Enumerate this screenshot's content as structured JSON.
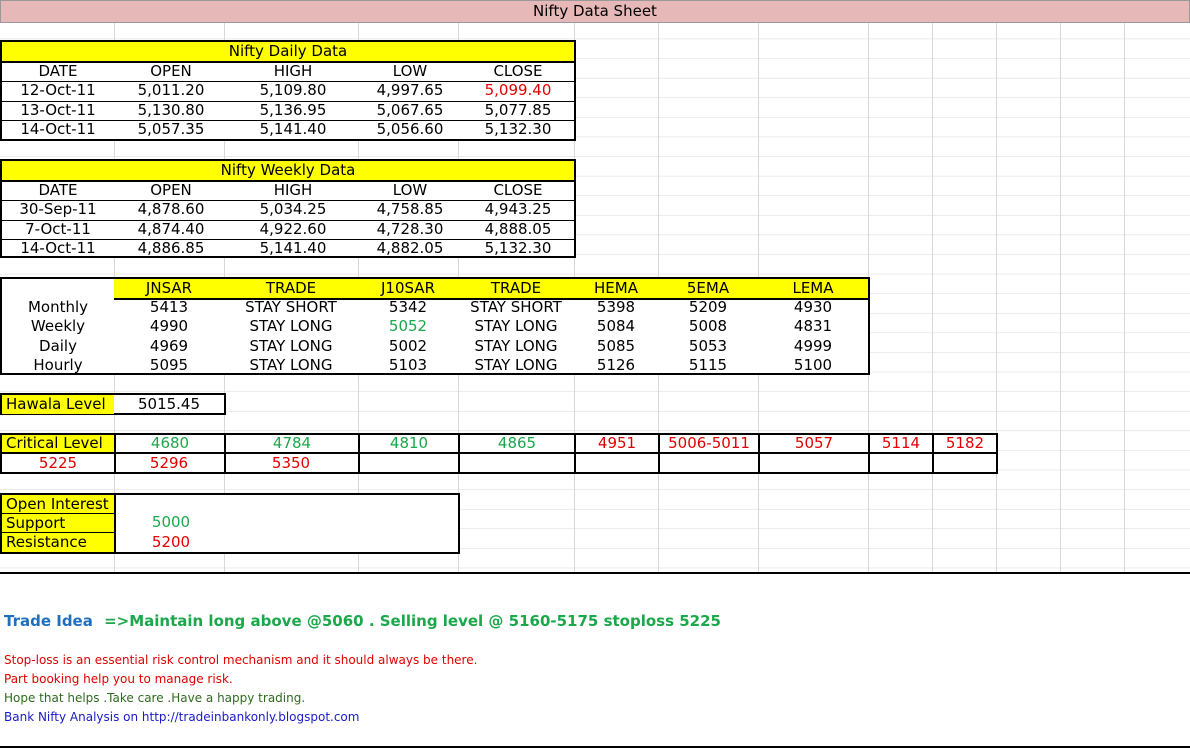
{
  "title": "Nifty Data Sheet",
  "daily": {
    "heading": "Nifty Daily Data",
    "columns": [
      "DATE",
      "OPEN",
      "HIGH",
      "LOW",
      "CLOSE"
    ],
    "rows": [
      [
        "12-Oct-11",
        "5,011.20",
        "5,109.80",
        "4,997.65",
        "5,099.40"
      ],
      [
        "13-Oct-11",
        "5,130.80",
        "5,136.95",
        "5,067.65",
        "5,077.85"
      ],
      [
        "14-Oct-11",
        "5,057.35",
        "5,141.40",
        "5,056.60",
        "5,132.30"
      ]
    ]
  },
  "weekly": {
    "heading": "Nifty Weekly Data",
    "columns": [
      "DATE",
      "OPEN",
      "HIGH",
      "LOW",
      "CLOSE"
    ],
    "rows": [
      [
        "30-Sep-11",
        "4,878.60",
        "5,034.25",
        "4,758.85",
        "4,943.25"
      ],
      [
        "7-Oct-11",
        "4,874.40",
        "4,922.60",
        "4,728.30",
        "4,888.05"
      ],
      [
        "14-Oct-11",
        "4,886.85",
        "5,141.40",
        "4,882.05",
        "5,132.30"
      ]
    ]
  },
  "indicators": {
    "columns": [
      "",
      "JNSAR",
      "TRADE",
      "J10SAR",
      "TRADE",
      "HEMA",
      "5EMA",
      "LEMA"
    ],
    "rows": [
      [
        "Monthly",
        "5413",
        "STAY SHORT",
        "5342",
        "STAY SHORT",
        "5398",
        "5209",
        "4930"
      ],
      [
        "Weekly",
        "4990",
        "STAY LONG",
        "5052",
        "STAY LONG",
        "5084",
        "5008",
        "4831"
      ],
      [
        "Daily",
        "4969",
        "STAY LONG",
        "5002",
        "STAY LONG",
        "5085",
        "5053",
        "4999"
      ],
      [
        "Hourly",
        "5095",
        "STAY LONG",
        "5103",
        "STAY LONG",
        "5126",
        "5115",
        "5100"
      ]
    ]
  },
  "hawala": {
    "label": "Hawala Level",
    "value": "5015.45"
  },
  "critical": {
    "label": "Critical Level",
    "row1": [
      "4680",
      "4784",
      "4810",
      "4865",
      "4951",
      "5006-5011",
      "5057",
      "5114",
      "5182"
    ],
    "row2": [
      "5225",
      "5296",
      "5350"
    ]
  },
  "open_interest": {
    "label": "Open Interest",
    "support_label": "Support",
    "support_value": "5000",
    "resistance_label": "Resistance",
    "resistance_value": "5200"
  },
  "trade_idea": {
    "label": "Trade Idea",
    "text": "=>Maintain long above @5060 . Selling level @  5160-5175 stoploss 5225"
  },
  "notes": [
    "Stop-loss is an essential risk control mechanism and it should always be there.",
    "Part booking help you to manage risk.",
    "Hope that helps .Take care .Have a happy trading.",
    "Bank Nifty Analysis on http://tradeinbankonly.blogspot.com"
  ],
  "colors": {
    "header_fill": "#e6b8b8",
    "highlight": "#ffff00",
    "support": "#1aa84a",
    "resistance": "#e00000",
    "trade_idea_label": "#1f6fbf",
    "link": "#1a1acc"
  }
}
